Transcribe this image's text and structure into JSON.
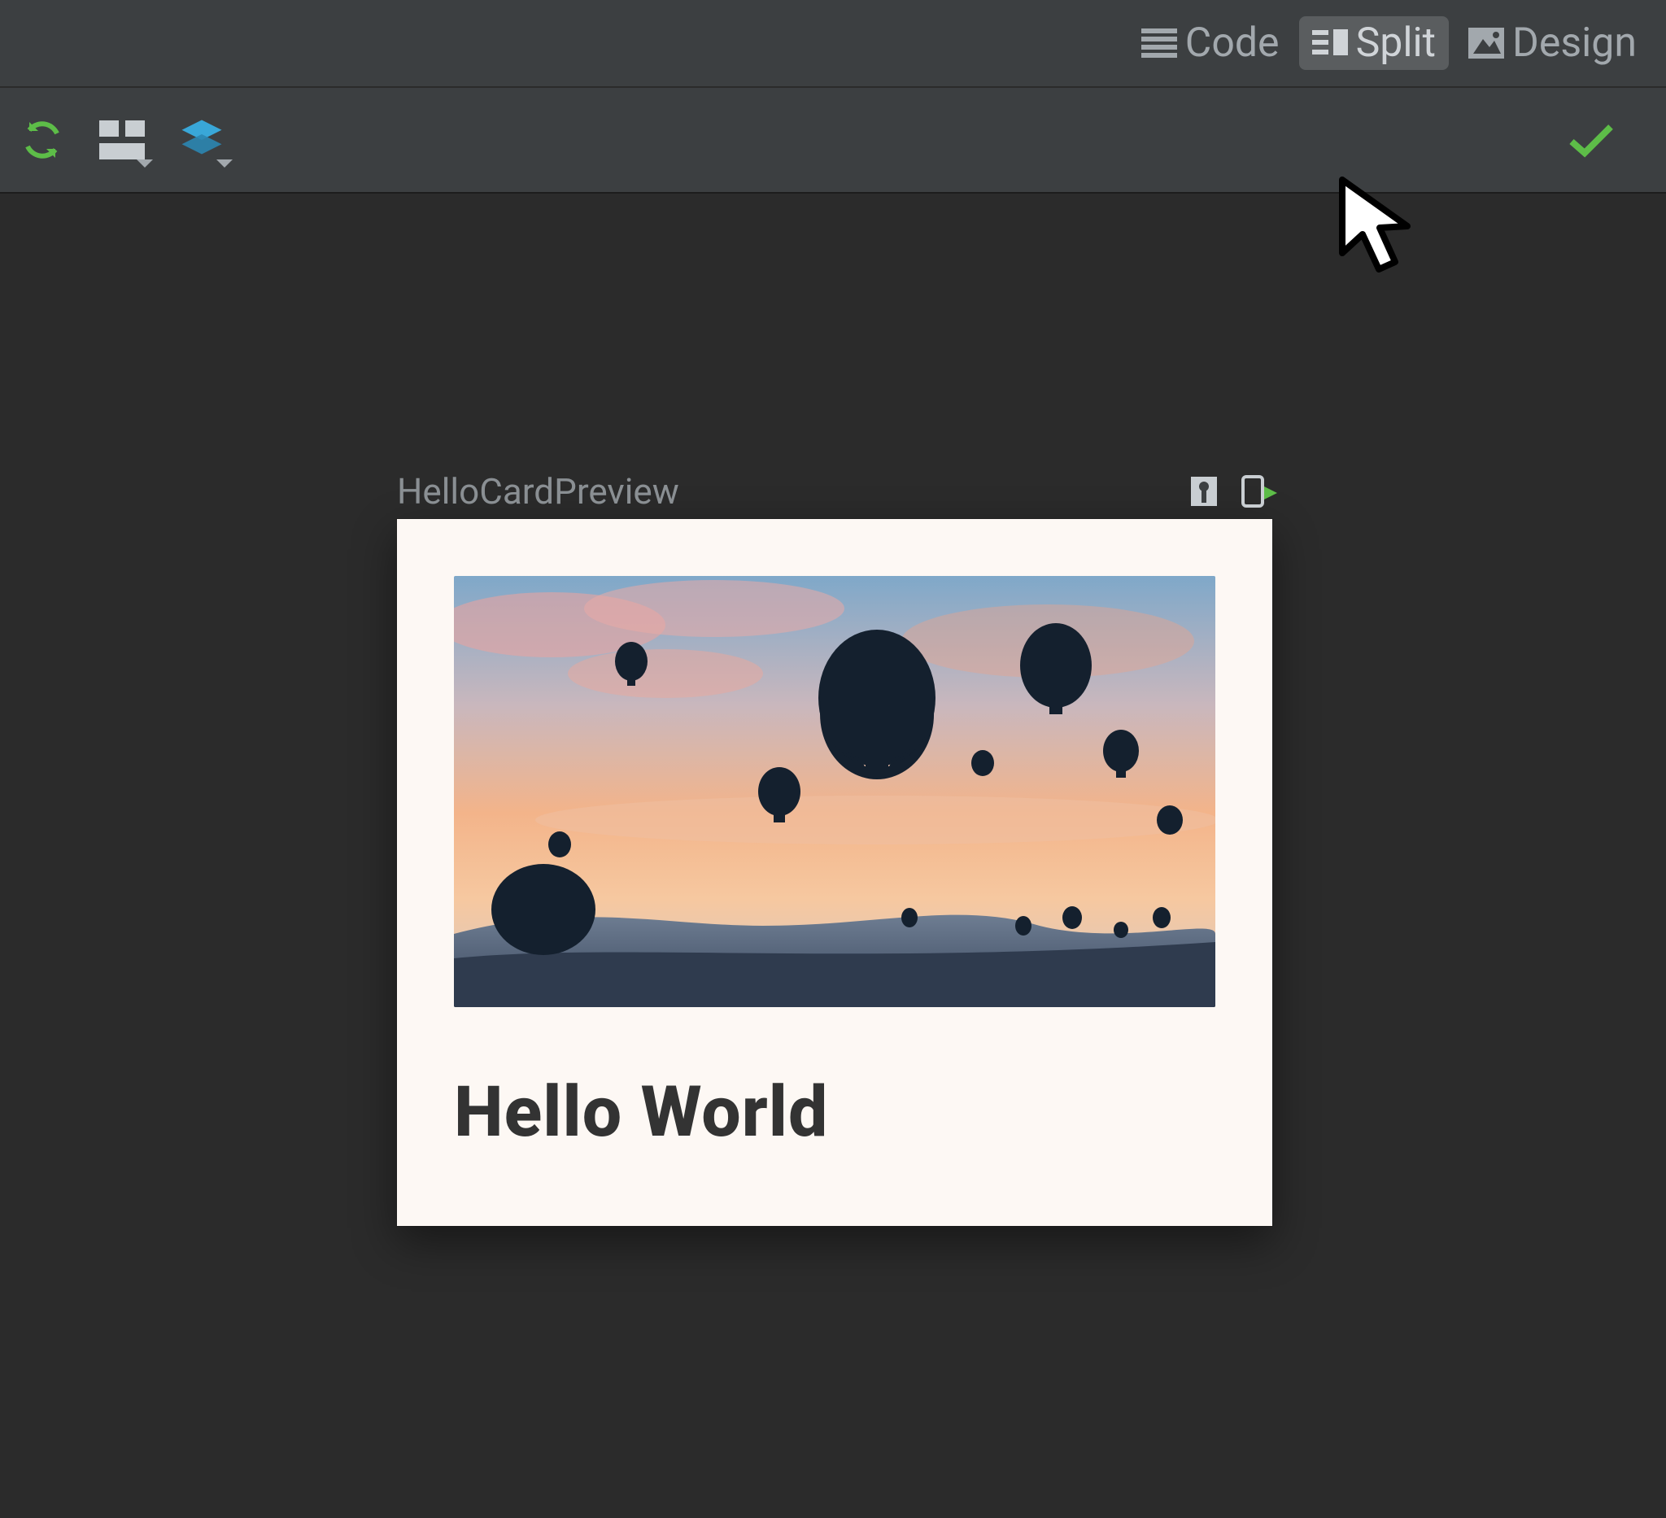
{
  "view_tabs": {
    "code_label": "Code",
    "split_label": "Split",
    "design_label": "Design",
    "selected": "split"
  },
  "toolbar": {
    "icons": {
      "refresh": "refresh-icon",
      "layout_panels": "layout-panels-icon",
      "stack": "stack-icon",
      "status_ok": "check-icon"
    }
  },
  "preview": {
    "title": "HelloCardPreview",
    "actions": {
      "interactive": "interactive-mode-icon",
      "deploy": "deploy-preview-icon"
    }
  },
  "card": {
    "title": "Hello World",
    "image_alt": "hot air balloons at sunset"
  },
  "icons": {
    "code": "hamburger-lines-icon",
    "split": "split-pane-icon",
    "design": "image-mountain-icon"
  }
}
